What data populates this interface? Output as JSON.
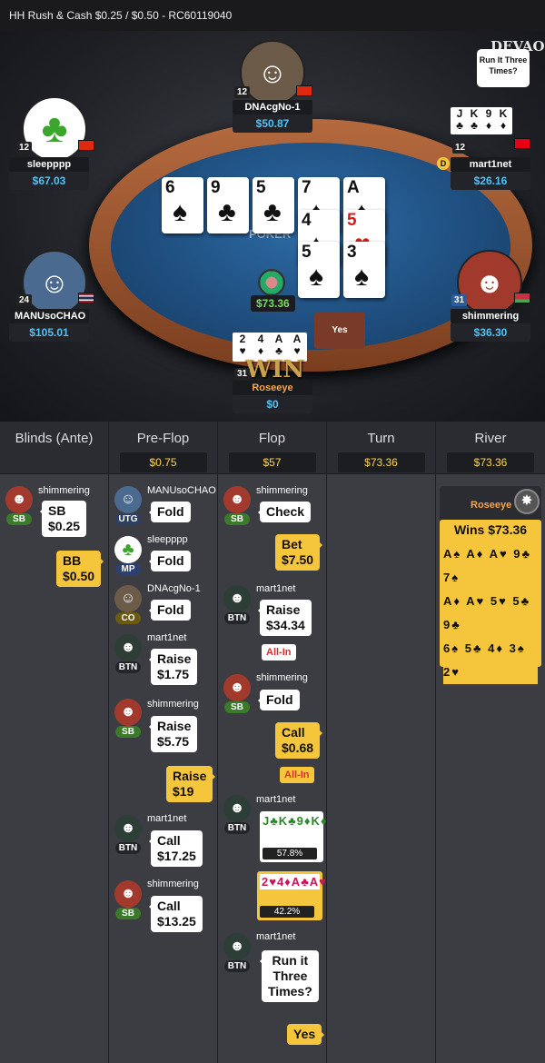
{
  "header": {
    "title": "HH  Rush & Cash $0.25 / $0.50   - RC60119040"
  },
  "table": {
    "brand": "POKER",
    "logo": "DEVAO",
    "pot": "$73.36",
    "hint_bubble": "Run It Three Times?",
    "yes_button": "Yes",
    "win_text": "WIN",
    "board": [
      {
        "rank": "6",
        "suit": "♠",
        "color": "#111"
      },
      {
        "rank": "9",
        "suit": "♣",
        "color": "#111"
      },
      {
        "rank": "5",
        "suit": "♣",
        "color": "#111"
      },
      {
        "rank": "7",
        "suit": "♠",
        "color": "#111"
      },
      {
        "rank": "A",
        "suit": "♠",
        "color": "#111"
      }
    ],
    "runout2": [
      {
        "rank": "4",
        "suit": "♠",
        "color": "#111"
      },
      {
        "rank": "5",
        "suit": "♥",
        "color": "#d41c1c"
      }
    ],
    "runout3": [
      {
        "rank": "5",
        "suit": "♠",
        "color": "#111"
      },
      {
        "rank": "3",
        "suit": "♠",
        "color": "#111"
      }
    ],
    "seats": {
      "top": {
        "name": "DNAcgNo-1",
        "stack": "$50.87",
        "level": "12"
      },
      "topleft": {
        "name": "sleepppp",
        "stack": "$67.03",
        "level": "12"
      },
      "topright": {
        "name": "mart1net",
        "stack": "$26.16",
        "level": "12",
        "dealer": "D",
        "cards": [
          "J",
          "K",
          "9",
          "K"
        ]
      },
      "left": {
        "name": "MANUsoCHAO",
        "stack": "$105.01",
        "level": "24"
      },
      "right": {
        "name": "shimmering",
        "stack": "$36.30",
        "level": "31"
      },
      "bottom": {
        "name": "Roseeye",
        "stack": "$0",
        "level": "31",
        "cards": [
          "2",
          "4",
          "A",
          "A"
        ]
      }
    }
  },
  "columns": {
    "blinds": {
      "title": "Blinds (Ante)"
    },
    "preflop": {
      "title": "Pre-Flop",
      "pot": "$0.75"
    },
    "flop": {
      "title": "Flop",
      "pot": "$57"
    },
    "turn": {
      "title": "Turn",
      "pot": "$73.36"
    },
    "river": {
      "title": "River",
      "pot": "$73.36"
    }
  },
  "actions": {
    "b1": {
      "name": "shimmering",
      "pos": "SB",
      "line1": "SB",
      "line2": "$0.25"
    },
    "b2": {
      "line1": "BB",
      "line2": "$0.50"
    },
    "p1": {
      "name": "MANUsoCHAO",
      "pos": "UTG",
      "act": "Fold"
    },
    "p2": {
      "name": "sleepppp",
      "pos": "MP",
      "act": "Fold"
    },
    "p3": {
      "name": "DNAcgNo-1",
      "pos": "CO",
      "act": "Fold"
    },
    "p4": {
      "name": "mart1net",
      "pos": "BTN",
      "line1": "Raise",
      "line2": "$1.75"
    },
    "p5": {
      "name": "shimmering",
      "pos": "SB",
      "line1": "Raise",
      "line2": "$5.75"
    },
    "p6": {
      "line1": "Raise",
      "line2": "$19"
    },
    "p7": {
      "name": "mart1net",
      "pos": "BTN",
      "line1": "Call",
      "line2": "$17.25"
    },
    "p8": {
      "name": "shimmering",
      "pos": "SB",
      "line1": "Call",
      "line2": "$13.25"
    },
    "f1": {
      "name": "shimmering",
      "pos": "SB",
      "act": "Check"
    },
    "f2": {
      "line1": "Bet",
      "line2": "$7.50"
    },
    "f3": {
      "name": "mart1net",
      "pos": "BTN",
      "line1": "Raise",
      "line2": "$34.34",
      "allin": "All-In"
    },
    "f4": {
      "name": "shimmering",
      "pos": "SB",
      "act": "Fold"
    },
    "f5": {
      "line1": "Call",
      "line2": "$0.68",
      "allin": "All-In"
    },
    "f6": {
      "name": "mart1net",
      "pos": "BTN",
      "equity": "57.8%"
    },
    "f7": {
      "equity": "42.2%"
    },
    "f8": {
      "name": "mart1net",
      "pos": "BTN",
      "line1": "Run it",
      "line2": "Three",
      "line3": "Times?"
    },
    "f9": {
      "act": "Yes"
    }
  },
  "river_result": {
    "name": "Roseeye",
    "wins": "Wins $73.36"
  },
  "colors": {
    "accent": "#f5c63b",
    "stack": "#4fc3f7",
    "felt": "#2d6ca6"
  }
}
